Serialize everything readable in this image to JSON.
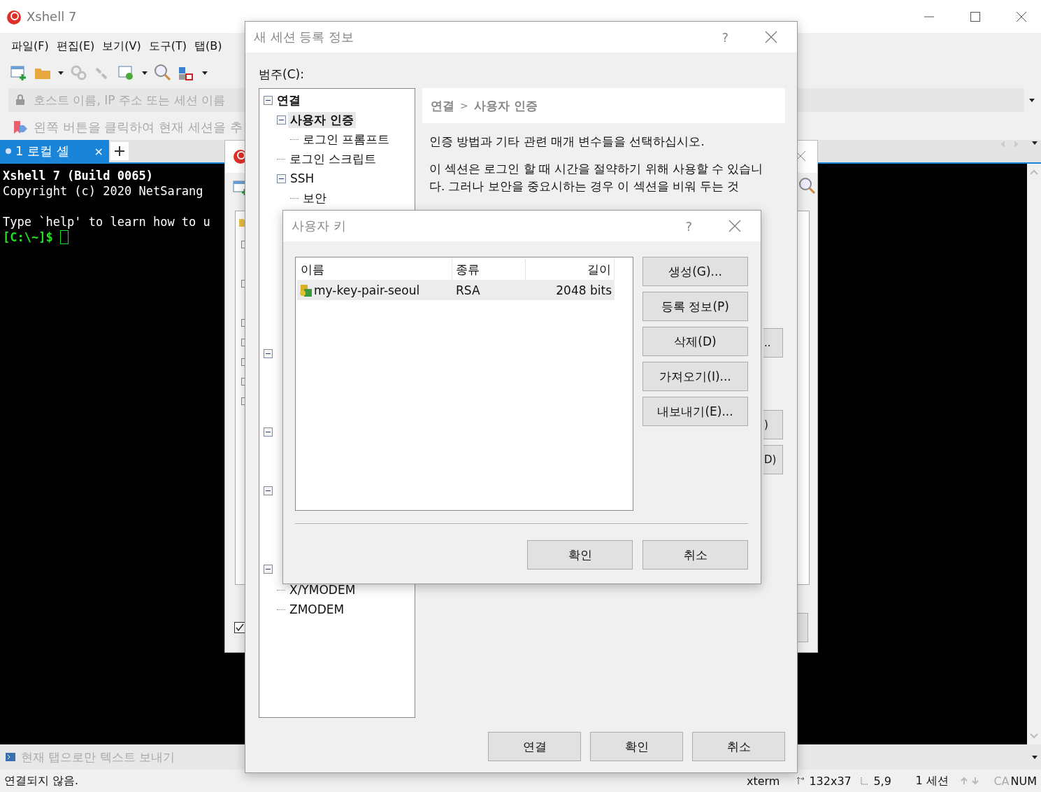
{
  "main_window": {
    "title": "Xshell 7",
    "menu": [
      "파일(F)",
      "편집(E)",
      "보기(V)",
      "도구(T)",
      "탭(B)"
    ],
    "address_field": {
      "placeholder": "호스트 이름, IP 주소 또는 세션 이름"
    },
    "hint": "왼쪽 버튼을 클릭하여 현재 세션을 추",
    "tabs": [
      {
        "label": "1 로컬 셸",
        "close": "×",
        "selected": true
      }
    ],
    "terminal": {
      "blocks": [
        [
          {
            "text": "Xshell 7 (Build 0065)",
            "kind": "bold"
          },
          {
            "text": "Copyright (c) 2020 NetSarang",
            "kind": "plain"
          }
        ],
        [
          {
            "text": "Type `help' to learn how to u",
            "kind": "plain"
          },
          {
            "text": "[C:\\~]$",
            "kind": "prompt"
          }
        ]
      ]
    },
    "send_bar": {
      "placeholder": "현재 탭으로만 텍스트 보내기"
    },
    "status_bar": {
      "message": "연결되지 않음.",
      "terminal_type": "xterm",
      "size": "132x37",
      "cursor": "5,9",
      "sessions": "1 세션",
      "caps": "CA",
      "num": "NUM"
    }
  },
  "session_manager": {
    "checkbox": {
      "checked": true
    }
  },
  "session_dialog": {
    "title": "새 세션 등록 정보",
    "help": "?",
    "category_label": "범주(C):",
    "tree": [
      {
        "label": "연결",
        "selected": false,
        "expanded": true,
        "children": [
          {
            "label": "사용자 인증",
            "selected": true,
            "expanded": true,
            "children": [
              {
                "label": "로그인 프롬프트",
                "selected": false
              }
            ]
          },
          {
            "label": "로그인 스크립트",
            "selected": false
          },
          {
            "label": "SSH",
            "selected": false,
            "expanded": true,
            "children": [
              {
                "label": "보안",
                "selected": false
              }
            ]
          }
        ]
      }
    ],
    "tree_tail": [
      "X/YMODEM",
      "ZMODEM"
    ],
    "breadcrumb": [
      "연결",
      "사용자 인증"
    ],
    "breadcrumb_separator": ">",
    "description": "인증 방법과 기타 관련 매개 변수들을 선택하십시오.",
    "note": "이 섹션은 로그인 할 때 시간을 절약하기 위해 사용할 수 있습니다. 그러나 보안을 중요시하는 경우 이 섹션을 비워 두는 것",
    "side_buttons": [
      "..",
      ")",
      "D)"
    ],
    "buttons": [
      "연결",
      "확인",
      "취소"
    ]
  },
  "key_dialog": {
    "title": "사용자 키",
    "help": "?",
    "columns": [
      "이름",
      "종류",
      "길이"
    ],
    "rows": [
      {
        "name": "my-key-pair-seoul",
        "type": "RSA",
        "length": "2048 bits",
        "selected": true
      }
    ],
    "actions": [
      "생성(G)...",
      "등록 정보(P)",
      "삭제(D)",
      "가져오기(I)...",
      "내보내기(E)..."
    ],
    "buttons": [
      "확인",
      "취소"
    ]
  }
}
